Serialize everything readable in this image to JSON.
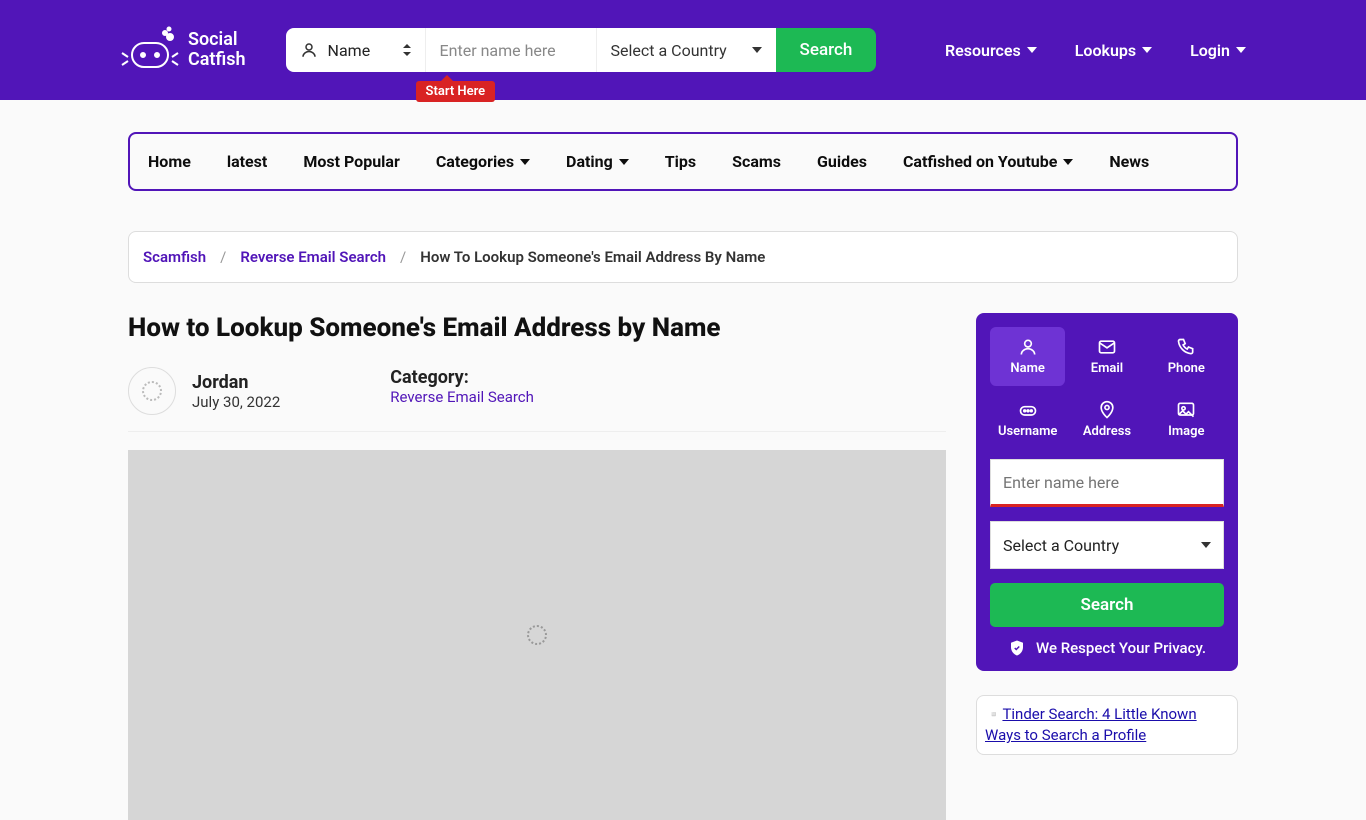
{
  "brand": {
    "line1": "Social",
    "line2": "Catfish"
  },
  "header_search": {
    "type_label": "Name",
    "input_placeholder": "Enter name here",
    "country_label": "Select a Country",
    "button": "Search",
    "start_here": "Start Here"
  },
  "header_nav": [
    "Resources",
    "Lookups",
    "Login"
  ],
  "category_nav": [
    {
      "label": "Home",
      "dropdown": false
    },
    {
      "label": "latest",
      "dropdown": false
    },
    {
      "label": "Most Popular",
      "dropdown": false
    },
    {
      "label": "Categories",
      "dropdown": true
    },
    {
      "label": "Dating",
      "dropdown": true
    },
    {
      "label": "Tips",
      "dropdown": false
    },
    {
      "label": "Scams",
      "dropdown": false
    },
    {
      "label": "Guides",
      "dropdown": false
    },
    {
      "label": "Catfished on Youtube",
      "dropdown": true
    },
    {
      "label": "News",
      "dropdown": false
    }
  ],
  "breadcrumb": {
    "items": [
      "Scamfish",
      "Reverse Email Search"
    ],
    "current": "How To Lookup Someone's Email Address By Name"
  },
  "article": {
    "title": "How to Lookup Someone's Email Address by Name",
    "author": "Jordan",
    "date": "July 30, 2022",
    "category_label": "Category:",
    "category_link": "Reverse Email Search"
  },
  "widget": {
    "tabs": [
      "Name",
      "Email",
      "Phone",
      "Username",
      "Address",
      "Image"
    ],
    "active_tab": 0,
    "input_placeholder": "Enter name here",
    "country_label": "Select a Country",
    "search_button": "Search",
    "privacy": "We Respect Your Privacy."
  },
  "related": {
    "alt_text": "Tinder Search: 4 Little Known Ways to Search a Profile"
  }
}
